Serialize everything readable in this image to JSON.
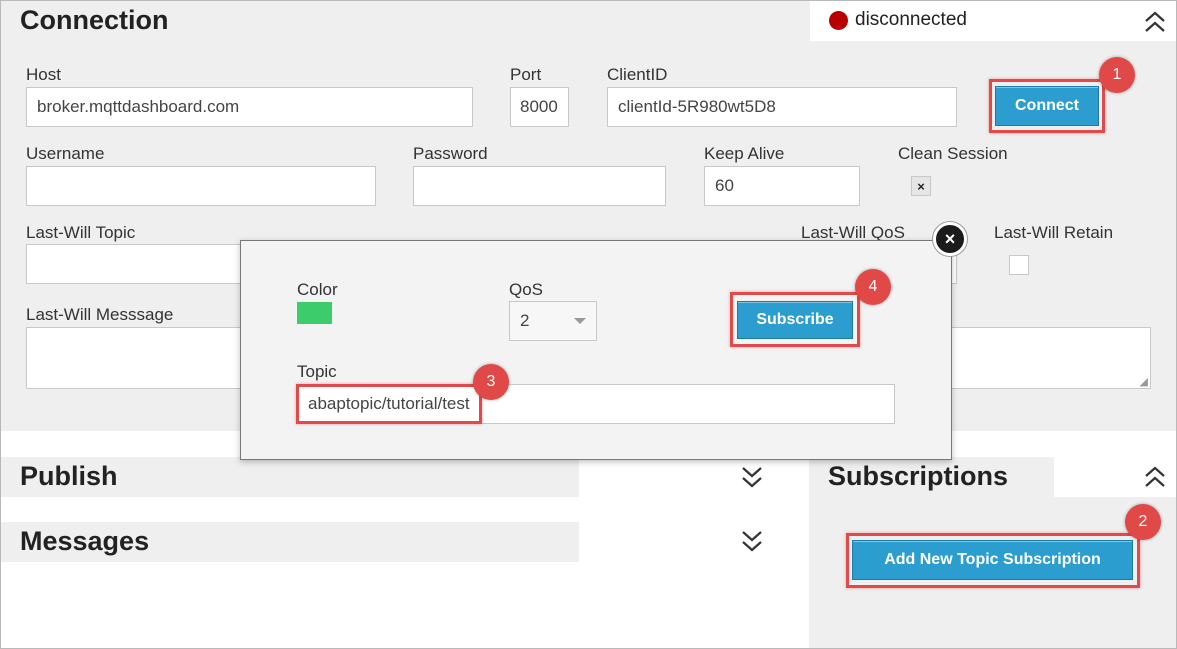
{
  "connection": {
    "title": "Connection",
    "status": "disconnected",
    "host_label": "Host",
    "host_value": "broker.mqttdashboard.com",
    "port_label": "Port",
    "port_value": "8000",
    "clientid_label": "ClientID",
    "clientid_value": "clientId-5R980wt5D8",
    "connect_label": "Connect",
    "username_label": "Username",
    "username_value": "",
    "password_label": "Password",
    "password_value": "",
    "keepalive_label": "Keep Alive",
    "keepalive_value": "60",
    "clean_session_label": "Clean Session",
    "clean_session_mark": "×",
    "lastwill_topic_label": "Last-Will Topic",
    "lastwill_qos_label": "Last-Will QoS",
    "lastwill_retain_label": "Last-Will Retain",
    "lastwill_message_label": "Last-Will Messsage"
  },
  "panels": {
    "publish_title": "Publish",
    "messages_title": "Messages",
    "subscriptions_title": "Subscriptions",
    "add_subscription_label": "Add New Topic Subscription"
  },
  "modal": {
    "close_glyph": "×",
    "color_label": "Color",
    "qos_label": "QoS",
    "qos_value": "2",
    "subscribe_label": "Subscribe",
    "topic_label": "Topic",
    "topic_value": "abaptopic/tutorial/test",
    "swatch_color": "#3ccc6b"
  },
  "badges": [
    "1",
    "2",
    "3",
    "4"
  ],
  "colors": {
    "accent_blue": "#2b9ecf",
    "highlight_red": "#e04a4a",
    "status_red": "#b80000"
  }
}
